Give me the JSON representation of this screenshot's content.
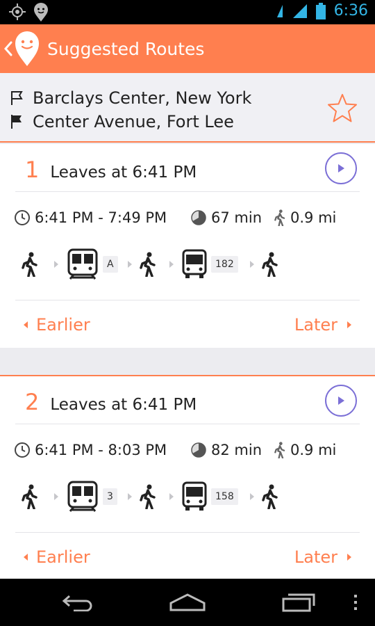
{
  "status_bar": {
    "time": "6:36",
    "icons": [
      "gps-icon",
      "app-notification-icon",
      "wifi-icon",
      "signal-icon",
      "battery-icon"
    ]
  },
  "action_bar": {
    "title": "Suggested Routes",
    "icons": [
      "back-chevron-icon",
      "app-logo-icon"
    ]
  },
  "trip": {
    "origin": "Barclays Center, New York",
    "destination": "Center Avenue, Fort Lee",
    "favorite_icon": "star-outline-icon"
  },
  "routes": [
    {
      "number": "1",
      "leaves": "Leaves at 6:41 PM",
      "time_range": "6:41 PM - 7:49 PM",
      "duration": "67 min",
      "walk_distance": "0.9 mi",
      "legs": [
        {
          "mode": "walk"
        },
        {
          "mode": "train",
          "label": "A"
        },
        {
          "mode": "walk"
        },
        {
          "mode": "bus",
          "label": "182"
        },
        {
          "mode": "walk"
        }
      ],
      "earlier_label": "Earlier",
      "later_label": "Later"
    },
    {
      "number": "2",
      "leaves": "Leaves at 6:41 PM",
      "time_range": "6:41 PM - 8:03 PM",
      "duration": "82 min",
      "walk_distance": "0.9 mi",
      "legs": [
        {
          "mode": "walk"
        },
        {
          "mode": "train",
          "label": "3"
        },
        {
          "mode": "walk"
        },
        {
          "mode": "bus",
          "label": "158"
        },
        {
          "mode": "walk"
        }
      ],
      "earlier_label": "Earlier",
      "later_label": "Later"
    }
  ],
  "colors": {
    "accent": "#ff7f4f",
    "play": "#7b6fd6",
    "status_time": "#33b5e5"
  },
  "nav_bar": {
    "icons": [
      "back-nav-icon",
      "home-nav-icon",
      "recent-apps-icon",
      "overflow-menu-icon"
    ]
  }
}
